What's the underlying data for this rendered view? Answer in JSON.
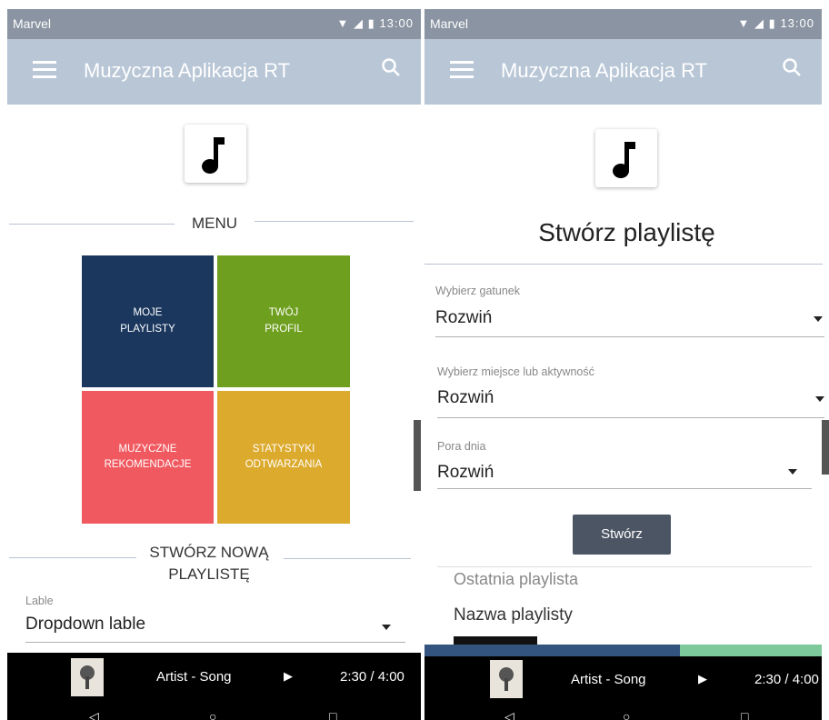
{
  "left": {
    "status_bar": {
      "carrier": "Marvel",
      "time": "13:00"
    },
    "toolbar": {
      "title": "Muzyczna Aplikacja RT"
    },
    "menu_heading": "MENU",
    "tiles": [
      {
        "line1": "MOJE",
        "line2": "PLAYLISTY",
        "color": "#1b375e"
      },
      {
        "line1": "TWÓJ",
        "line2": "PROFIL",
        "color": "#6f9f1f"
      },
      {
        "line1": "MUZYCZNE",
        "line2": "REKOMENDACJE",
        "color": "#f0595f"
      },
      {
        "line1": "STATYSTYKI",
        "line2": "ODTWARZANIA",
        "color": "#dcaa2d"
      }
    ],
    "create_heading_line1": "STWÓRZ NOWĄ",
    "create_heading_line2": "PLAYLISTĘ",
    "dropdown": {
      "label": "Lable",
      "value": "Dropdown lable"
    },
    "player": {
      "track": "Artist - Song",
      "time": "2:30 / 4:00"
    }
  },
  "right": {
    "status_bar": {
      "carrier": "Marvel",
      "time": "13:00"
    },
    "toolbar": {
      "title": "Muzyczna Aplikacja RT"
    },
    "page_title": "Stwórz playlistę",
    "dropdowns": [
      {
        "label": "Wybierz gatunek",
        "value": "Rozwiń"
      },
      {
        "label": "Wybierz miejsce lub aktywność",
        "value": "Rozwiń"
      },
      {
        "label": "Pora dnia",
        "value": "Rozwiń"
      }
    ],
    "create_button": "Stwórz",
    "recent_heading": "Ostatnia playlista",
    "recent_name": "Nazwa playlisty",
    "player": {
      "track": "Artist - Song",
      "time": "2:30 / 4:00"
    }
  },
  "colors": {
    "accent_blue": "#33547f",
    "accent_green": "#7dc99b",
    "button": "#4b5563"
  }
}
